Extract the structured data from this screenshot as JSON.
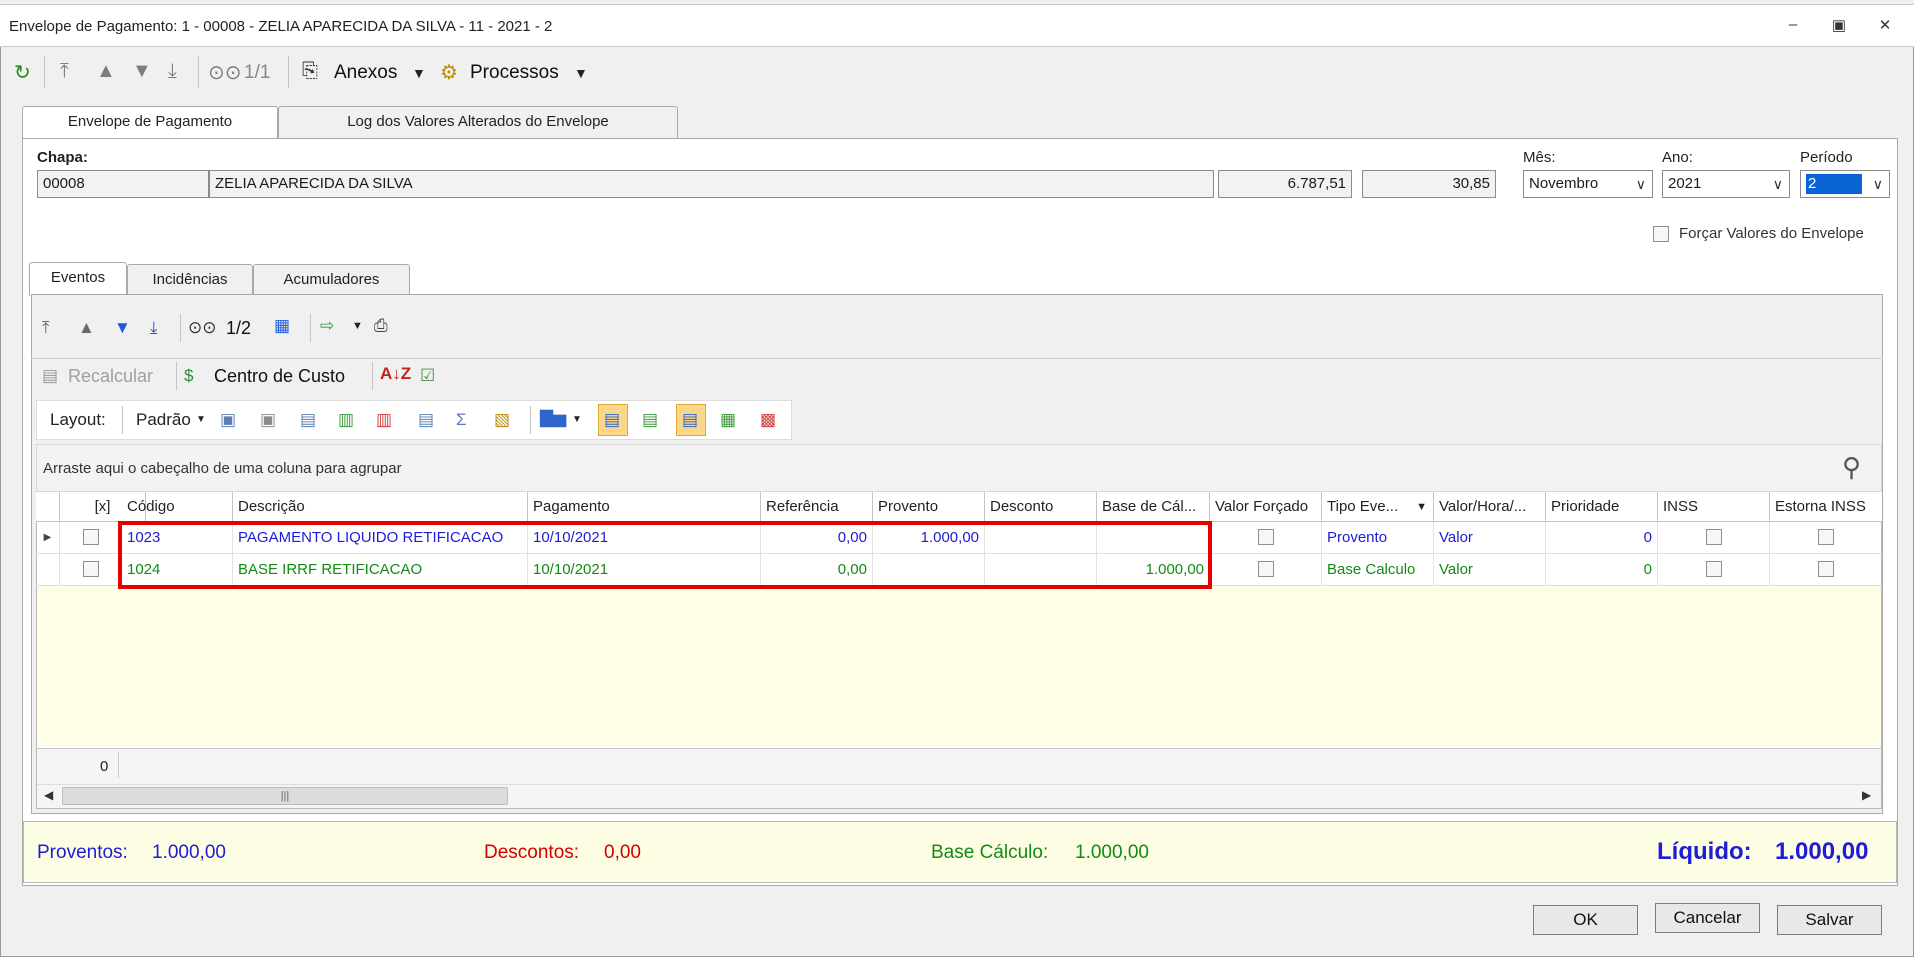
{
  "window": {
    "title": "Envelope de Pagamento: 1 - 00008 - ZELIA APARECIDA DA SILVA - 11 - 2021 - 2",
    "record_position": "1/1"
  },
  "toolbar": {
    "anexos_label": "Anexos",
    "processos_label": "Processos"
  },
  "tabs": [
    {
      "label": "Envelope de Pagamento"
    },
    {
      "label": "Log dos Valores Alterados do Envelope"
    }
  ],
  "header": {
    "chapa_label": "Chapa:",
    "chapa": "00008",
    "nome": "ZELIA APARECIDA DA SILVA",
    "valor1": "6.787,51",
    "valor2": "30,85",
    "mes_label": "Mês:",
    "mes_value": "Novembro",
    "ano_label": "Ano:",
    "ano_value": "2021",
    "periodo_label": "Período",
    "periodo_value": "2",
    "forcar_label": "Forçar Valores do Envelope"
  },
  "subtabs": [
    {
      "label": "Eventos"
    },
    {
      "label": "Incidências"
    },
    {
      "label": "Acumuladores"
    }
  ],
  "events_toolbar": {
    "record_position": "1/2",
    "recalcular_label": "Recalcular",
    "centro_custo_label": "Centro de Custo",
    "layout_label": "Layout:",
    "padrao_label": "Padrão"
  },
  "grid": {
    "group_hint": "Arraste aqui o cabeçalho de uma coluna para agrupar",
    "columns": [
      "[x]",
      "Código",
      "Descrição",
      "Pagamento",
      "Referência",
      "Provento",
      "Desconto",
      "Base de Cál...",
      "Valor Forçado",
      "Tipo Eve...",
      "Valor/Hora/...",
      "Prioridade",
      "INSS",
      "Estorna INSS"
    ],
    "rows": [
      {
        "codigo": "1023",
        "descricao": "PAGAMENTO LIQUIDO RETIFICACAO",
        "pagamento": "10/10/2021",
        "referencia": "0,00",
        "provento": "1.000,00",
        "desconto": "",
        "base": "",
        "tipo": "Provento",
        "valor_hora": "Valor",
        "prioridade": "0"
      },
      {
        "codigo": "1024",
        "descricao": "BASE IRRF RETIFICACAO",
        "pagamento": "10/10/2021",
        "referencia": "0,00",
        "provento": "",
        "desconto": "",
        "base": "1.000,00",
        "tipo": "Base Calculo",
        "valor_hora": "Valor",
        "prioridade": "0"
      }
    ],
    "footer_count": "0"
  },
  "summary": {
    "proventos_label": "Proventos:",
    "proventos_value": "1.000,00",
    "descontos_label": "Descontos:",
    "descontos_value": "0,00",
    "base_label": "Base Cálculo:",
    "base_value": "1.000,00",
    "liquido_label": "Líquido:",
    "liquido_value": "1.000,00"
  },
  "buttons": {
    "ok": "OK",
    "cancelar": "Cancelar",
    "salvar": "Salvar"
  },
  "colors": {
    "accent_blue": "#1d1dd6",
    "accent_green": "#138a13",
    "accent_red": "#d40000",
    "highlight_frame": "#e60000",
    "summary_bg": "#fdfde4"
  }
}
